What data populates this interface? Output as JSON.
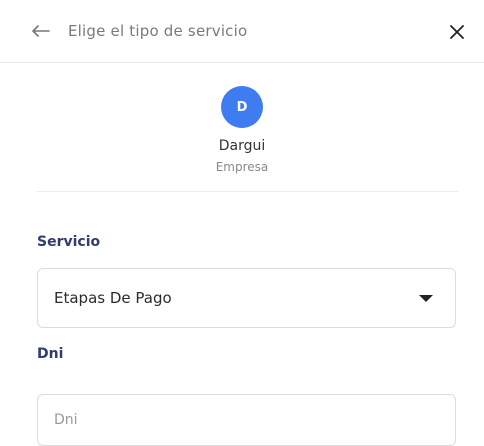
{
  "header": {
    "title": "Elige el tipo de servicio",
    "back_icon": "arrow-left-icon",
    "close_icon": "close-icon"
  },
  "company": {
    "avatar_letter": "D",
    "avatar_color": "#3f7cf2",
    "name": "Dargui",
    "type": "Empresa"
  },
  "form": {
    "servicio_label": "Servicio",
    "servicio_value": "Etapas De Pago",
    "dni_label": "Dni",
    "dni_placeholder": "Dni"
  },
  "colors": {
    "label": "#2f3d6f",
    "accent": "#3f7cf2"
  }
}
